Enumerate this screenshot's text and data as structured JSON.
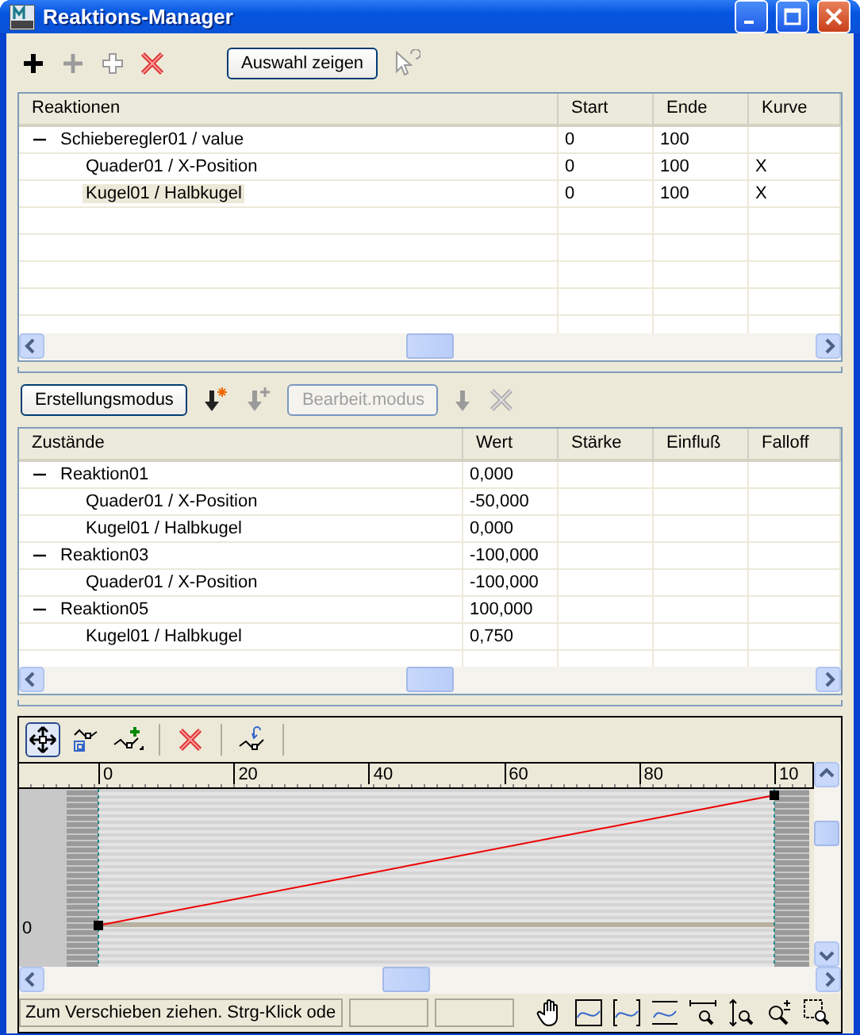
{
  "window": {
    "title": "Reaktions-Manager"
  },
  "toolbar": [
    {
      "kind": "add",
      "disabled": false
    },
    {
      "kind": "add",
      "disabled": true
    },
    {
      "kind": "add-outline",
      "disabled": true
    },
    {
      "kind": "delete",
      "disabled": false
    },
    {
      "kind": "button",
      "label": "Auswahl zeigen",
      "disabled": false
    },
    {
      "kind": "pick",
      "disabled": true
    }
  ],
  "reactions": {
    "columns": [
      "Reaktionen",
      "Start",
      "Ende",
      "Kurve"
    ],
    "rows": [
      {
        "cells": [
          "Schieberegler01 / value",
          "0",
          "100"
        ],
        "expanded": true,
        "selected": false,
        "children": [
          {
            "cells": [
              "Quader01 / X-Position",
              "0",
              "100",
              "X"
            ],
            "selected": false
          },
          {
            "cells": [
              "Kugel01 / Halbkugel",
              "0",
              "100",
              "X"
            ],
            "selected": true
          }
        ]
      }
    ]
  },
  "state_toolbar": [
    {
      "kind": "button",
      "label": "Erstellungsmodus",
      "disabled": false
    },
    {
      "kind": "arrow-new",
      "disabled": false
    },
    {
      "kind": "arrow-add",
      "disabled": true
    },
    {
      "kind": "button",
      "label": "Bearbeit.modus",
      "disabled": true
    },
    {
      "kind": "arrow",
      "disabled": true
    },
    {
      "kind": "delete",
      "disabled": true
    }
  ],
  "states": {
    "columns": [
      "Zustände",
      "Wert",
      "Stärke",
      "Einfluß",
      "Falloff"
    ],
    "rows": [
      {
        "cells": [
          "Reaktion01",
          "0,000"
        ],
        "expanded": true,
        "children": [
          {
            "cells": [
              "Quader01 / X-Position",
              "-50,000"
            ]
          },
          {
            "cells": [
              "Kugel01 / Halbkugel",
              "0,000"
            ]
          }
        ]
      },
      {
        "cells": [
          "Reaktion03",
          "-100,000"
        ],
        "expanded": true,
        "children": [
          {
            "cells": [
              "Quader01 / X-Position",
              "-100,000"
            ]
          }
        ]
      },
      {
        "cells": [
          "Reaktion05",
          "100,000"
        ],
        "expanded": true,
        "children": [
          {
            "cells": [
              "Kugel01 / Halbkugel",
              "0,750"
            ]
          }
        ]
      }
    ]
  },
  "curve_toolbar": [
    {
      "kind": "move",
      "selected": true
    },
    {
      "kind": "scale",
      "selected": false
    },
    {
      "kind": "insert",
      "selected": false
    },
    {
      "kind": "separator"
    },
    {
      "kind": "delete",
      "selected": false
    },
    {
      "kind": "separator"
    },
    {
      "kind": "reset",
      "selected": false
    },
    {
      "kind": "separator"
    }
  ],
  "curve": {
    "ruler_labels": [
      "0",
      "20",
      "40",
      "60",
      "80",
      "10"
    ],
    "y_label": "0"
  },
  "status_bar": {
    "text": "Zum Verschieben ziehen. Strg-Klick ode"
  }
}
